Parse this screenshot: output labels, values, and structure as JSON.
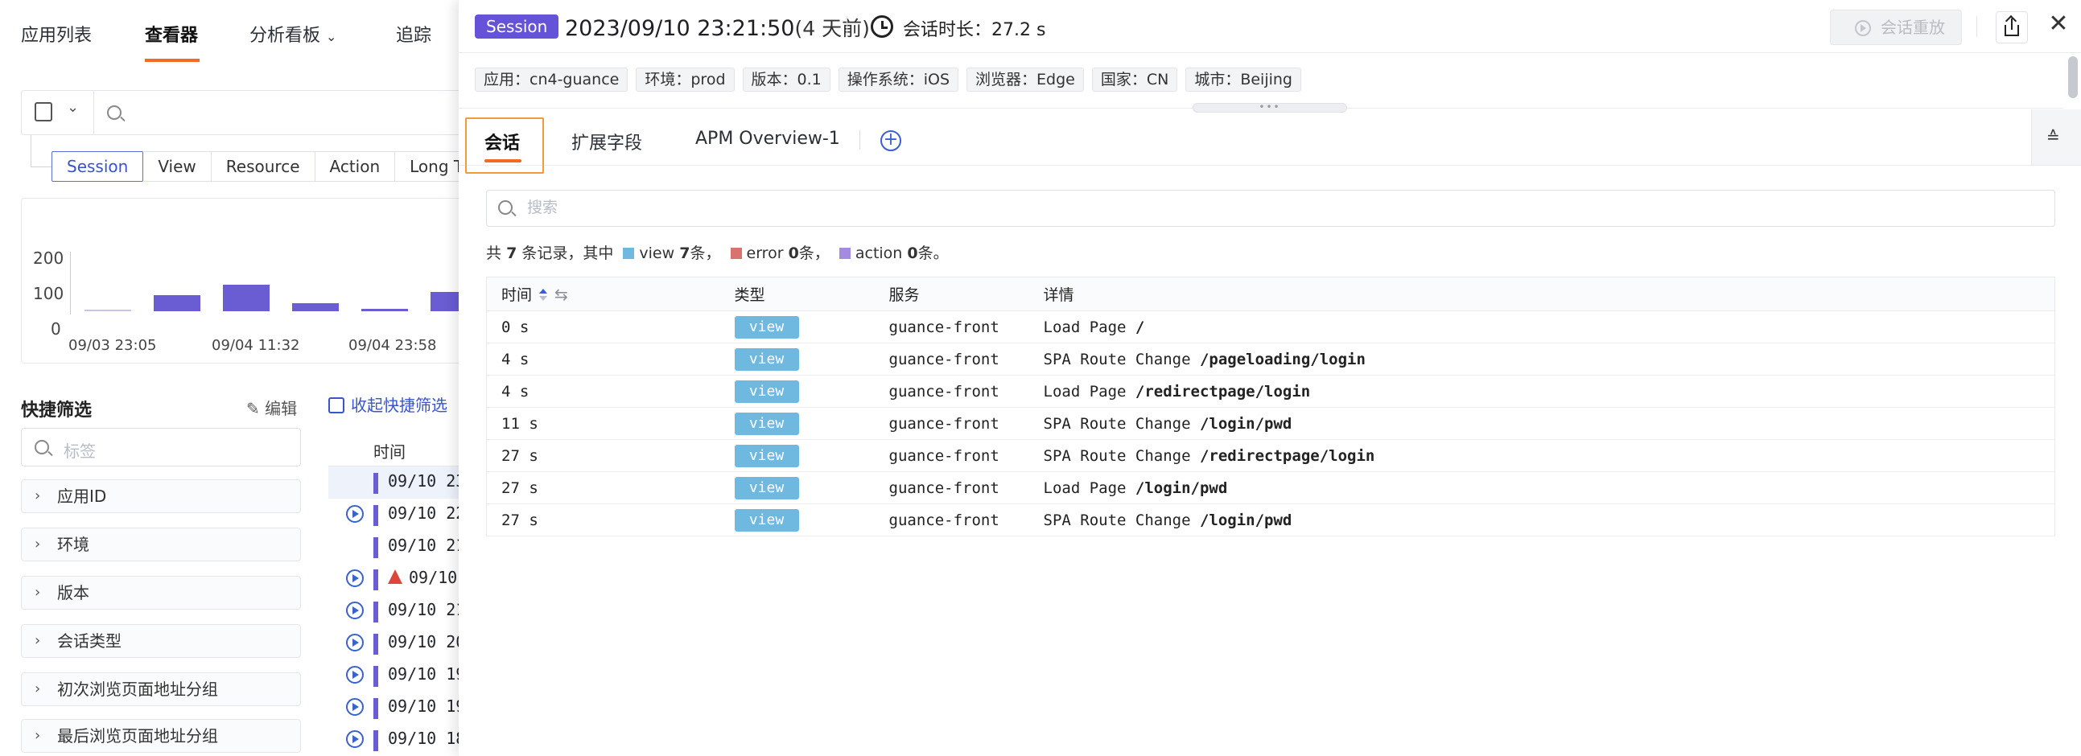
{
  "app": {
    "nav": [
      "应用列表",
      "查看器",
      "分析看板",
      "追踪"
    ],
    "nav_active": "查看器"
  },
  "explorer": {
    "source_tabs": [
      "Session",
      "View",
      "Resource",
      "Action",
      "Long T"
    ],
    "source_active": "Session",
    "histogram": {
      "y_ticks": [
        "200",
        "100",
        "0"
      ],
      "x_ticks": [
        "09/03 23:05",
        "09/04 11:32",
        "09/04 23:58"
      ]
    },
    "quick_filter": {
      "title": "快捷筛选",
      "edit_label": "编辑",
      "collapse_label": "收起快捷筛选",
      "search_placeholder": "标签",
      "facets": [
        "应用ID",
        "环境",
        "版本",
        "会话类型",
        "初次浏览页面地址分组",
        "最后浏览页面地址分组"
      ]
    },
    "list": {
      "header_time": "时间",
      "rows": [
        "09/10 23",
        "09/10 22",
        "09/10 21",
        "09/10",
        "09/10 21",
        "09/10 20",
        "09/10 19",
        "09/10 19",
        "09/10 18"
      ]
    }
  },
  "session": {
    "badge": "Session",
    "datetime": "2023/09/10 23:21:50",
    "ago": "(4 天前)",
    "duration_label": "会话时长：27.2 s",
    "replay_label": "会话重放",
    "tags": [
      "应用：cn4-guance",
      "环境：prod",
      "版本：0.1",
      "操作系统：iOS",
      "浏览器：Edge",
      "国家：CN",
      "城市：Beijing"
    ],
    "tabs": [
      "会话",
      "扩展字段",
      "APM Overview-1"
    ],
    "tab_active": "会话",
    "search_placeholder": "搜索",
    "summary": {
      "prefix": "共",
      "total": "7",
      "mid": "条记录，其中",
      "view_label": "view",
      "view_count": "7",
      "error_label": "error",
      "error_count": "0",
      "action_label": "action",
      "action_count": "0",
      "unit": "条，",
      "end": "条。"
    },
    "colors": {
      "view": "#6fb8e0",
      "error": "#d9736f",
      "action": "#a48be0",
      "accent": "#f36a21",
      "session_badge": "#6453d8"
    },
    "table": {
      "columns": [
        "时间",
        "类型",
        "服务",
        "详情"
      ],
      "rows": [
        {
          "time": "0 s",
          "type": "view",
          "service": "guance-front",
          "action": "Load Page",
          "path": "/"
        },
        {
          "time": "4 s",
          "type": "view",
          "service": "guance-front",
          "action": "SPA Route Change",
          "path": "/pageloading/login"
        },
        {
          "time": "4 s",
          "type": "view",
          "service": "guance-front",
          "action": "Load Page",
          "path": "/redirectpage/login"
        },
        {
          "time": "11 s",
          "type": "view",
          "service": "guance-front",
          "action": "SPA Route Change",
          "path": "/login/pwd"
        },
        {
          "time": "27 s",
          "type": "view",
          "service": "guance-front",
          "action": "SPA Route Change",
          "path": "/redirectpage/login"
        },
        {
          "time": "27 s",
          "type": "view",
          "service": "guance-front",
          "action": "Load Page",
          "path": "/login/pwd"
        },
        {
          "time": "27 s",
          "type": "view",
          "service": "guance-front",
          "action": "SPA Route Change",
          "path": "/login/pwd"
        }
      ]
    }
  }
}
